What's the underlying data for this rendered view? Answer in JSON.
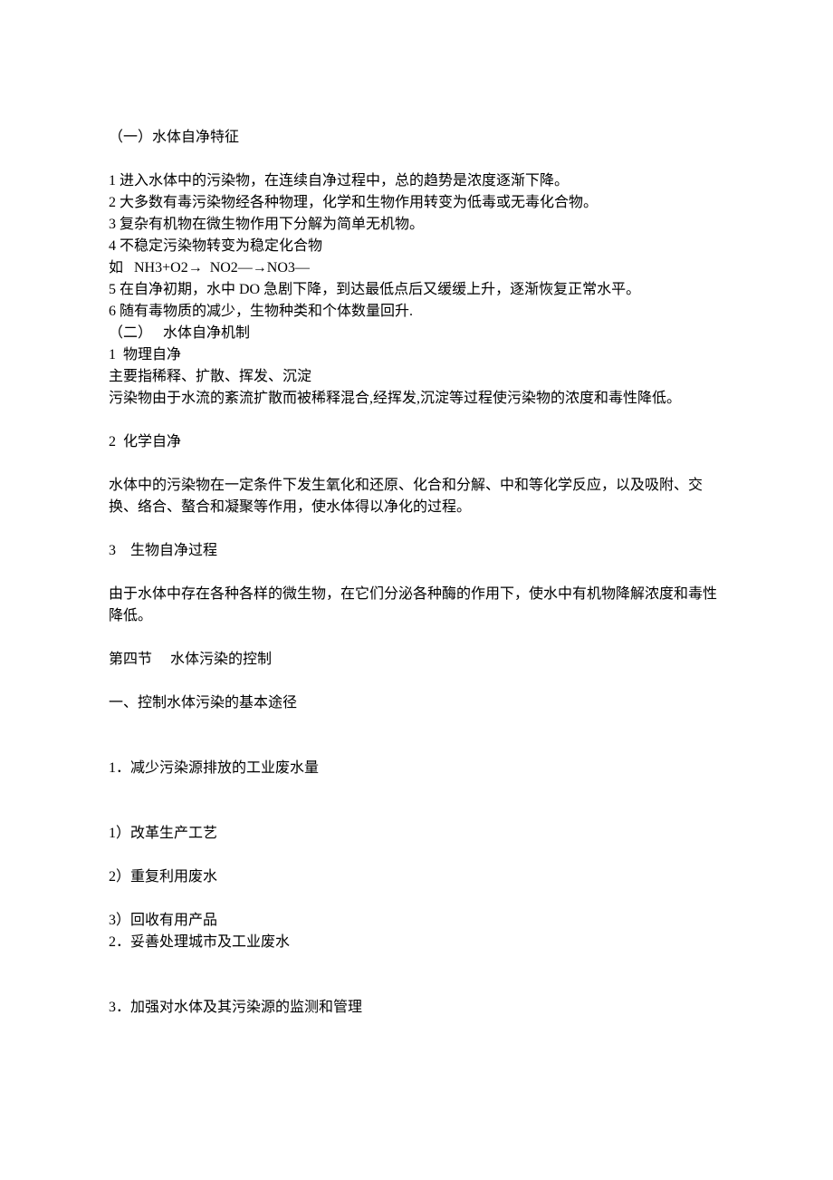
{
  "lines": [
    "（一）水体自净特征",
    "",
    "1 进入水体中的污染物，在连续自净过程中，总的趋势是浓度逐渐下降。",
    "2 大多数有毒污染物经各种物理，化学和生物作用转变为低毒或无毒化合物。",
    "3 复杂有机物在微生物作用下分解为简单无机物。",
    "4 不稳定污染物转变为稳定化合物",
    "如   NH3+O2→  NO2—→NO3—",
    "5 在自净初期，水中 DO 急剧下降，到达最低点后又缓缓上升，逐渐恢复正常水平。",
    "6 随有毒物质的减少，生物种类和个体数量回升.",
    "（二）   水体自净机制",
    "1  物理自净",
    "主要指稀释、扩散、挥发、沉淀",
    "污染物由于水流的紊流扩散而被稀释混合,经挥发,沉淀等过程使污染物的浓度和毒性降低。",
    "",
    "2  化学自净",
    "",
    "水体中的污染物在一定条件下发生氧化和还原、化合和分解、中和等化学反应，以及吸附、交换、络合、螯合和凝聚等作用，使水体得以净化的过程。",
    "",
    "3    生物自净过程",
    "",
    "由于水体中存在各种各样的微生物，在它们分泌各种酶的作用下，使水中有机物降解浓度和毒性降低。",
    "",
    "第四节     水体污染的控制",
    "",
    "一、控制水体污染的基本途径",
    "",
    "",
    "1．减少污染源排放的工业废水量",
    "",
    "",
    "1）改革生产工艺",
    "",
    "2）重复利用废水",
    "",
    "3）回收有用产品",
    "2．妥善处理城市及工业废水",
    "",
    "",
    "3．加强对水体及其污染源的监测和管理"
  ]
}
